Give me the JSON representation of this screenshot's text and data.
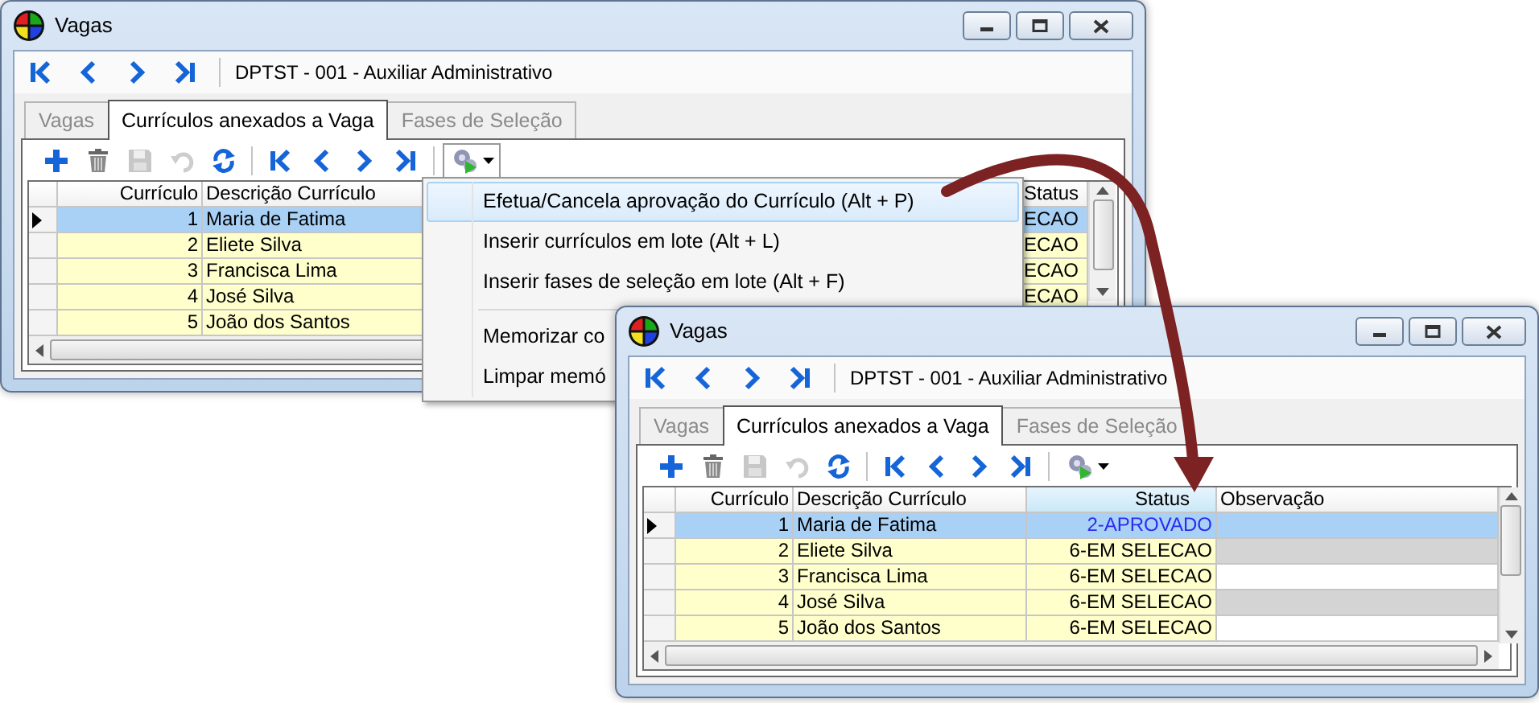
{
  "windows": [
    {
      "title": "Vagas",
      "record": "DPTST - 001 - Auxiliar Administrativo",
      "tabs": [
        {
          "label": "Vagas",
          "selected": false
        },
        {
          "label": "Currículos anexados a Vaga",
          "selected": true
        },
        {
          "label": "Fases de Seleção",
          "selected": false
        }
      ],
      "toolbar": [
        {
          "kind": "add",
          "disabled": false
        },
        {
          "kind": "delete",
          "disabled": false
        },
        {
          "kind": "save",
          "disabled": true
        },
        {
          "kind": "undo",
          "disabled": true
        },
        {
          "kind": "refresh",
          "disabled": false
        },
        {
          "kind": "separator"
        },
        {
          "kind": "first",
          "disabled": false
        },
        {
          "kind": "previous",
          "disabled": false
        },
        {
          "kind": "next",
          "disabled": false
        },
        {
          "kind": "last",
          "disabled": false
        },
        {
          "kind": "separator"
        },
        {
          "kind": "actions",
          "disabled": false,
          "open": true
        }
      ],
      "grid": {
        "columns": [
          "Currículo",
          "Descrição Currículo",
          "Status"
        ],
        "rows": [
          {
            "selected": true,
            "values": [
              "1",
              "Maria de Fatima",
              "ECAO"
            ]
          },
          {
            "selected": false,
            "values": [
              "2",
              "Eliete Silva",
              "ECAO"
            ]
          },
          {
            "selected": false,
            "values": [
              "3",
              "Francisca Lima",
              "ECAO"
            ]
          },
          {
            "selected": false,
            "values": [
              "4",
              "José Silva",
              "ECAO"
            ]
          },
          {
            "selected": false,
            "values": [
              "5",
              "João dos Santos"
            ]
          }
        ]
      },
      "menu": [
        {
          "kind": "item",
          "label": "Efetua/Cancela aprovação do Currículo (Alt + P)",
          "selected": true
        },
        {
          "kind": "item",
          "label": "Inserir currículos em lote (Alt + L)",
          "selected": false
        },
        {
          "kind": "item",
          "label": "Inserir fases de seleção em lote (Alt + F)",
          "selected": false
        },
        {
          "kind": "separator"
        },
        {
          "kind": "item",
          "label": "Memorizar co",
          "selected": false
        },
        {
          "kind": "item",
          "label": "Limpar memó",
          "selected": false
        }
      ]
    },
    {
      "title": "Vagas",
      "record": "DPTST - 001 - Auxiliar Administrativo",
      "tabs": [
        {
          "label": "Vagas",
          "selected": false
        },
        {
          "label": "Currículos anexados a Vaga",
          "selected": true
        },
        {
          "label": "Fases de Seleção",
          "selected": false
        }
      ],
      "toolbar": [
        {
          "kind": "add",
          "disabled": false
        },
        {
          "kind": "delete",
          "disabled": false
        },
        {
          "kind": "save",
          "disabled": true
        },
        {
          "kind": "undo",
          "disabled": true
        },
        {
          "kind": "refresh",
          "disabled": false
        },
        {
          "kind": "separator"
        },
        {
          "kind": "first",
          "disabled": false
        },
        {
          "kind": "previous",
          "disabled": false
        },
        {
          "kind": "next",
          "disabled": false
        },
        {
          "kind": "last",
          "disabled": false
        },
        {
          "kind": "separator"
        },
        {
          "kind": "actions",
          "disabled": false,
          "open": false
        }
      ],
      "grid": {
        "columns": [
          "Currículo",
          "Descrição Currículo",
          "Status",
          "Observação"
        ],
        "rows": [
          {
            "selected": true,
            "color": "#2b2bf0",
            "values": [
              "1",
              "Maria de Fatima",
              "2-APROVADO"
            ]
          },
          {
            "selected": false,
            "color": "#000000",
            "values": [
              "2",
              "Eliete Silva",
              "6-EM SELECAO"
            ]
          },
          {
            "selected": false,
            "color": "#000000",
            "values": [
              "3",
              "Francisca Lima",
              "6-EM SELECAO"
            ]
          },
          {
            "selected": false,
            "color": "#000000",
            "values": [
              "4",
              "José Silva",
              "6-EM SELECAO"
            ]
          },
          {
            "selected": false,
            "color": "#000000",
            "values": [
              "5",
              "João dos Santos",
              "6-EM SELECAO"
            ]
          }
        ]
      }
    }
  ]
}
